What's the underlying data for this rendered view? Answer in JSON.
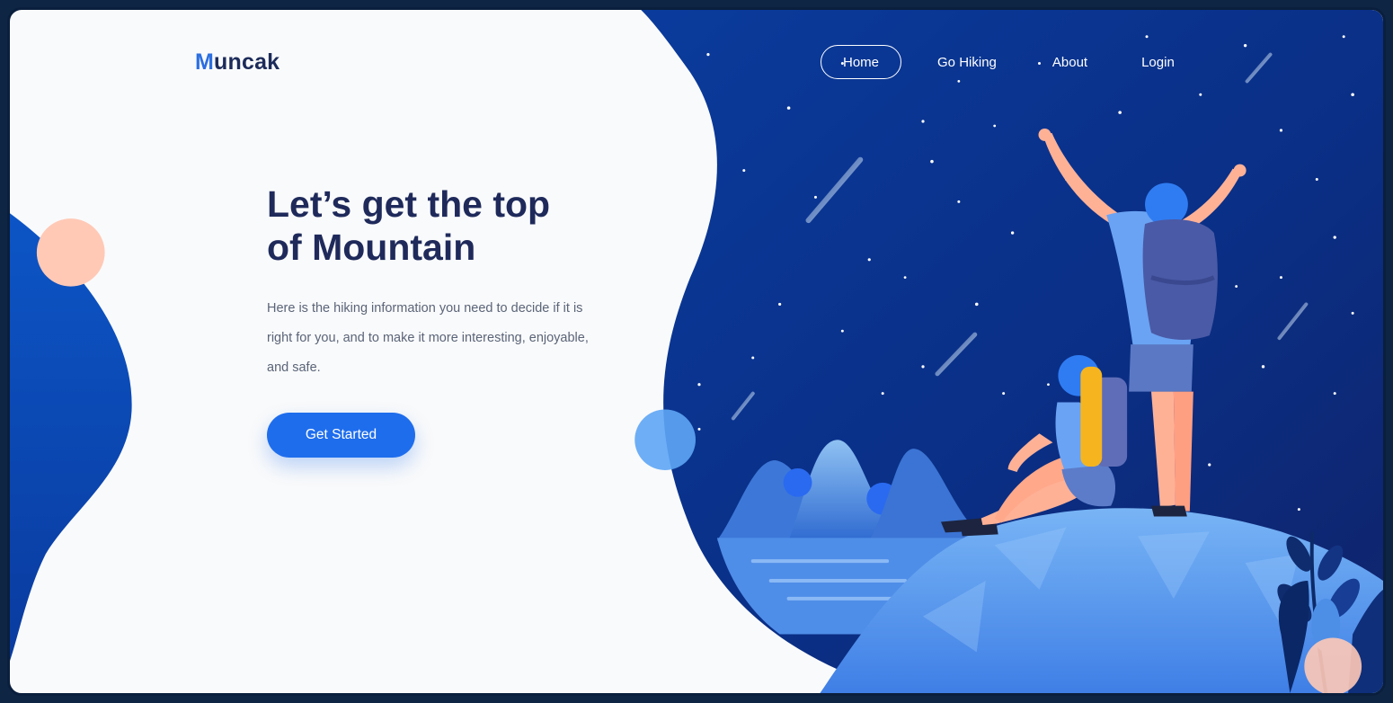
{
  "brand": {
    "logo_initial": "M",
    "logo_rest": "uncak"
  },
  "nav": {
    "items": [
      {
        "label": "Home",
        "active": true
      },
      {
        "label": "Go Hiking"
      },
      {
        "label": "About"
      },
      {
        "label": "Login"
      }
    ]
  },
  "hero": {
    "title_line1": "Let’s get the top",
    "title_line2": "of Mountain",
    "description": "Here is the hiking information you need to decide if it is right for you, and to make it more interesting, enjoyable, and safe.",
    "cta_label": "Get Started"
  },
  "colors": {
    "brand_blue": "#1e6ded",
    "night_sky": "#0b2f8a",
    "heading_navy": "#1f2a5b",
    "accent_peach": "#ffc9b6"
  }
}
